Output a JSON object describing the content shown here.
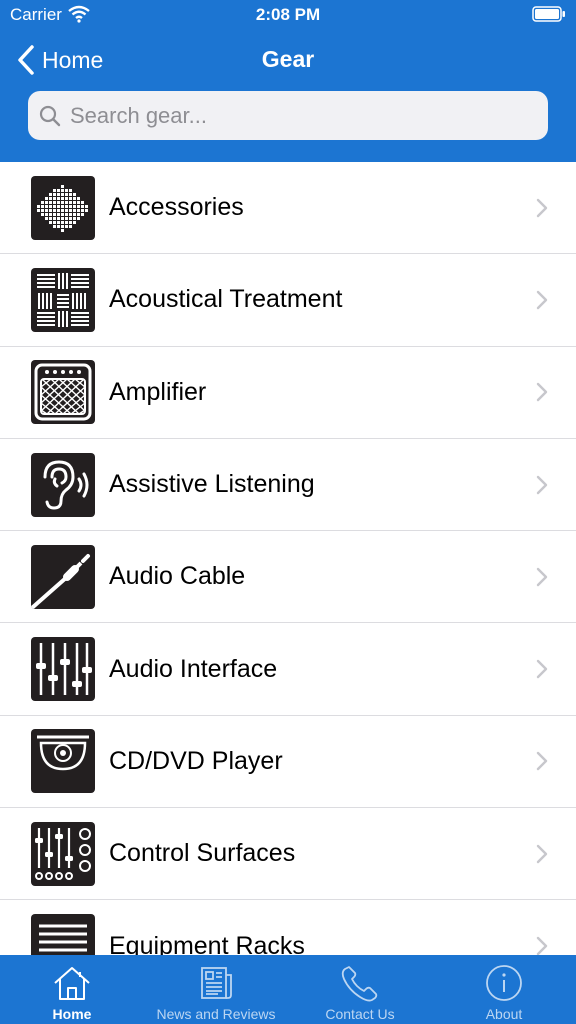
{
  "status": {
    "carrier": "Carrier",
    "time": "2:08 PM"
  },
  "nav": {
    "back_label": "Home",
    "title": "Gear"
  },
  "search": {
    "placeholder": "Search gear..."
  },
  "colors": {
    "brand": "#1c75d2",
    "icon_bg": "#231f20",
    "chevron": "#c7c7cc"
  },
  "items": [
    {
      "label": "Accessories",
      "icon": "sound-wave-icon"
    },
    {
      "label": "Acoustical Treatment",
      "icon": "acoustic-panel-icon"
    },
    {
      "label": "Amplifier",
      "icon": "amplifier-icon"
    },
    {
      "label": "Assistive Listening",
      "icon": "ear-icon"
    },
    {
      "label": "Audio Cable",
      "icon": "audio-cable-icon"
    },
    {
      "label": "Audio Interface",
      "icon": "faders-icon"
    },
    {
      "label": "CD/DVD Player",
      "icon": "disc-player-icon"
    },
    {
      "label": "Control Surfaces",
      "icon": "control-surface-icon"
    },
    {
      "label": "Equipment Racks",
      "icon": "rack-icon"
    }
  ],
  "tabs": [
    {
      "label": "Home",
      "icon": "house-icon",
      "active": true
    },
    {
      "label": "News and Reviews",
      "icon": "newspaper-icon",
      "active": false
    },
    {
      "label": "Contact Us",
      "icon": "phone-icon",
      "active": false
    },
    {
      "label": "About",
      "icon": "info-icon",
      "active": false
    }
  ]
}
